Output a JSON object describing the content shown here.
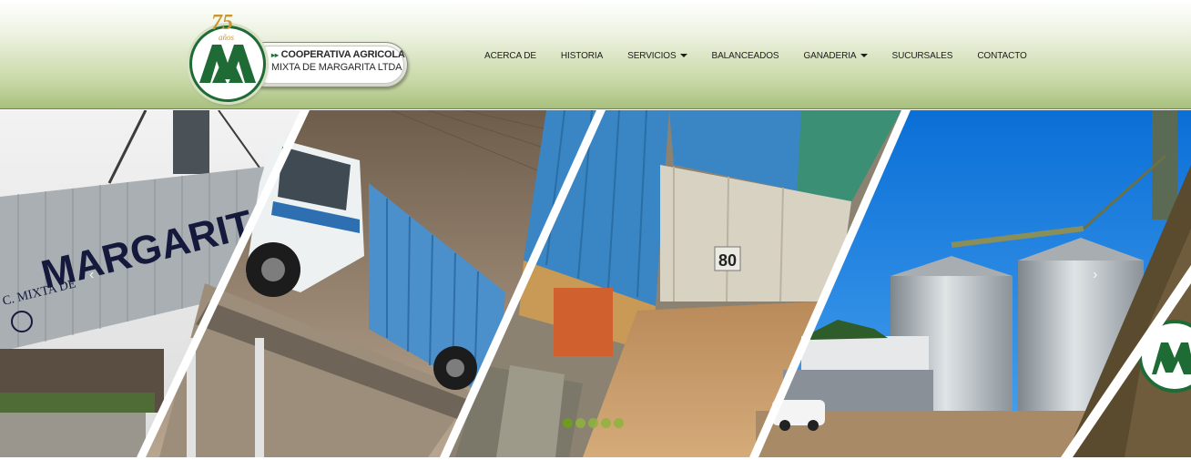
{
  "logo": {
    "anniversary": "75",
    "anniversary_label": "años",
    "name_line1": "COOPERATIVA AGRICOLA",
    "name_line2": "MIXTA DE MARGARITA LTDA",
    "icon": "cooperative-logo-icon"
  },
  "nav": {
    "items": [
      {
        "label": "ACERCA DE",
        "dropdown": false
      },
      {
        "label": "HISTORIA",
        "dropdown": false
      },
      {
        "label": "SERVICIOS",
        "dropdown": true
      },
      {
        "label": "BALANCEADOS",
        "dropdown": false
      },
      {
        "label": "GANADERIA",
        "dropdown": true
      },
      {
        "label": "SUCURSALES",
        "dropdown": false
      },
      {
        "label": "CONTACTO",
        "dropdown": false
      }
    ]
  },
  "slider": {
    "panels": [
      {
        "name": "silo-building",
        "sign_text": "MARGARITA",
        "sign_small": "C. MIXTA DE"
      },
      {
        "name": "truck-ramp"
      },
      {
        "name": "grain-unloading",
        "plate": "80"
      },
      {
        "name": "silos"
      },
      {
        "name": "logo-panel"
      }
    ],
    "dots": 5,
    "active_dot": 0,
    "prev_icon": "chevron-left-icon",
    "next_icon": "chevron-right-icon"
  },
  "colors": {
    "brand_green": "#1f6b35",
    "header_gradient_end": "#a8c07e",
    "dot_green": "#8fb33d",
    "gold": "#c9962f"
  }
}
